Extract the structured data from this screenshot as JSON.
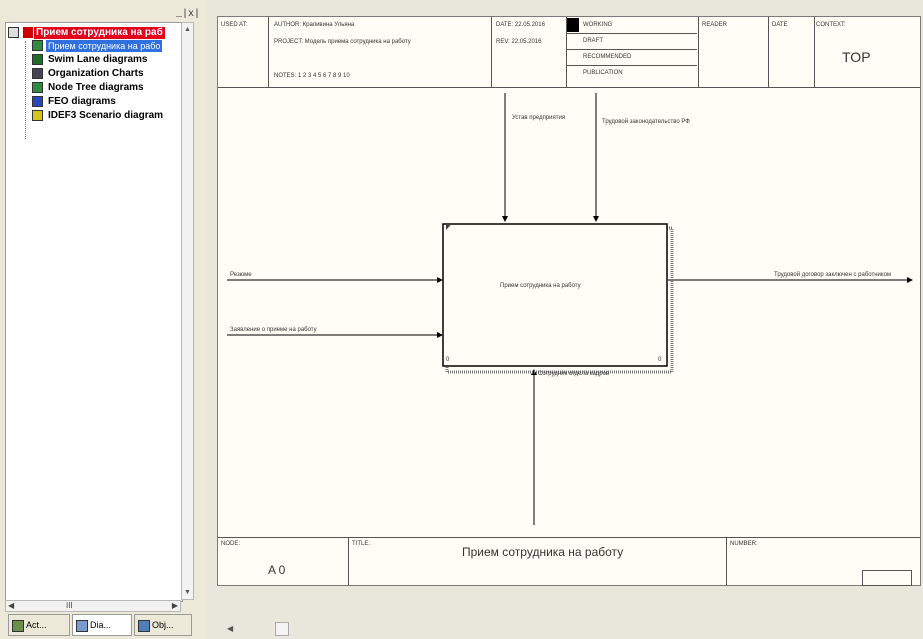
{
  "explorer": {
    "close_glyphs": "_|x|",
    "tree": [
      {
        "label": "Прием сотрудника на раб",
        "icon": "model-icon",
        "state": "root-highlight"
      },
      {
        "label": "Прием сотрудника на рабо",
        "icon": "idef0-diagram-icon",
        "state": "selected"
      },
      {
        "label": "Swim Lane diagrams",
        "icon": "swimlane-icon",
        "state": "normal"
      },
      {
        "label": "Organization Charts",
        "icon": "org-chart-icon",
        "state": "normal"
      },
      {
        "label": "Node Tree diagrams",
        "icon": "node-tree-icon",
        "state": "normal"
      },
      {
        "label": "FEO diagrams",
        "icon": "feo-icon",
        "state": "normal"
      },
      {
        "label": "IDEF3 Scenario diagram",
        "icon": "idef3-icon",
        "state": "normal"
      }
    ],
    "hscroll_label": "III",
    "tabs": [
      {
        "label": "Act..."
      },
      {
        "label": "Dia..."
      },
      {
        "label": "Obj..."
      }
    ]
  },
  "header": {
    "used_at": "USED AT:",
    "author": "AUTHOR: Крапивина Ульяна",
    "project": "PROJECT: Модель приема сотрудника на работу",
    "notes": "NOTES: 1 2 3 4 5 6 7 8 9 10",
    "date": "DATE: 22.05.2016",
    "rev": "REV: 22.05.2016",
    "status_working": "WORKING",
    "status_draft": "DRAFT",
    "status_recommended": "RECOMMENDED",
    "status_publication": "PUBLICATION",
    "reader": "READER",
    "date2": "DATE",
    "context_label": "CONTEXT:",
    "context_value": "TOP"
  },
  "diagram": {
    "box_label": "Прием сотрудника на работу",
    "control_1": "Устав предприятия",
    "control_2": "Трудовой законодательство РФ",
    "input_1": "Резюме",
    "input_2": "Заявление о приеме на работу",
    "output_1": "Трудовой договор заключен с работником",
    "mechanism_1": "Сотрудник отдела кадров"
  },
  "footer": {
    "node_label": "NODE:",
    "node_value": "A 0",
    "title_label": "TITLE:",
    "title_value": "Прием сотрудника на работу",
    "number_label": "NUMBER:"
  },
  "colors": {
    "root_highlight": "#e2001a",
    "selected": "#2f6fe0"
  }
}
